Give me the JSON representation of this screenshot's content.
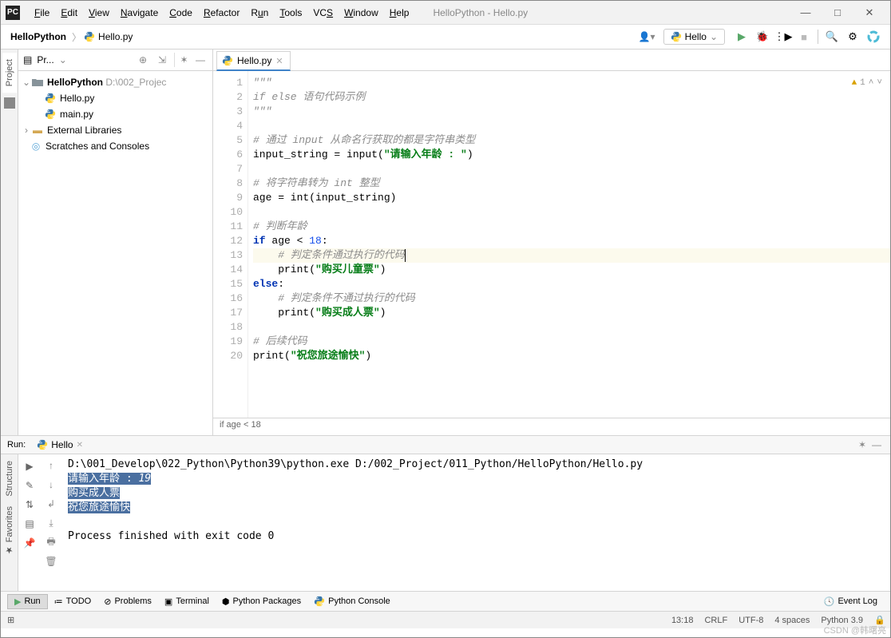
{
  "window_title": "HelloPython - Hello.py",
  "menu": [
    "File",
    "Edit",
    "View",
    "Navigate",
    "Code",
    "Refactor",
    "Run",
    "Tools",
    "VCS",
    "Window",
    "Help"
  ],
  "breadcrumbs": {
    "root": "HelloPython",
    "file": "Hello.py"
  },
  "run_config": "Hello",
  "project_panel": {
    "title": "Pr...",
    "tree": {
      "project_name": "HelloPython",
      "project_path": "D:\\002_Projec",
      "files": [
        "Hello.py",
        "main.py"
      ],
      "external": "External Libraries",
      "scratches": "Scratches and Consoles"
    }
  },
  "side_tab_project": "Project",
  "editor_tab": "Hello.py",
  "inspections_count": "1",
  "code": {
    "l1": "\"\"\"",
    "l2": "if else 语句代码示例",
    "l3": "\"\"\"",
    "l4": "",
    "l5": "# 通过 input 从命名行获取的都是字符串类型",
    "l6a": "input_string = input(",
    "l6b": "\"请输入年龄 : \"",
    "l6c": ")",
    "l7": "",
    "l8": "# 将字符串转为 int 整型",
    "l9": "age = int(input_string)",
    "l10": "",
    "l11": "# 判断年龄",
    "l12a": "if",
    "l12b": " age < ",
    "l12c": "18",
    "l12d": ":",
    "l13": "    # 判定条件通过执行的代码",
    "l14a": "    print(",
    "l14b": "\"购买儿童票\"",
    "l14c": ")",
    "l15a": "else",
    "l15b": ":",
    "l16": "    # 判定条件不通过执行的代码",
    "l17a": "    print(",
    "l17b": "\"购买成人票\"",
    "l17c": ")",
    "l18": "",
    "l19": "# 后续代码",
    "l20a": "print(",
    "l20b": "\"祝您旅途愉快\"",
    "l20c": ")"
  },
  "breadcrumb_context": "if age < 18",
  "run": {
    "title": "Run:",
    "tab": "Hello",
    "cmd": "D:\\001_Develop\\022_Python\\Python39\\python.exe D:/002_Project/011_Python/HelloPython/Hello.py",
    "prompt": "请输入年龄 : ",
    "input": "19",
    "out1": "购买成人票",
    "out2": "祝您旅途愉快",
    "exit": "Process finished with exit code 0"
  },
  "side_tabs_left": [
    "Structure",
    "Favorites"
  ],
  "bottom_tabs": {
    "run": "Run",
    "todo": "TODO",
    "problems": "Problems",
    "terminal": "Terminal",
    "packages": "Python Packages",
    "console": "Python Console",
    "eventlog": "Event Log"
  },
  "status": {
    "linecol": "13:18",
    "eol": "CRLF",
    "enc": "UTF-8",
    "indent": "4 spaces",
    "interp": "Python 3.9"
  },
  "watermark": "CSDN @韩曙亮"
}
